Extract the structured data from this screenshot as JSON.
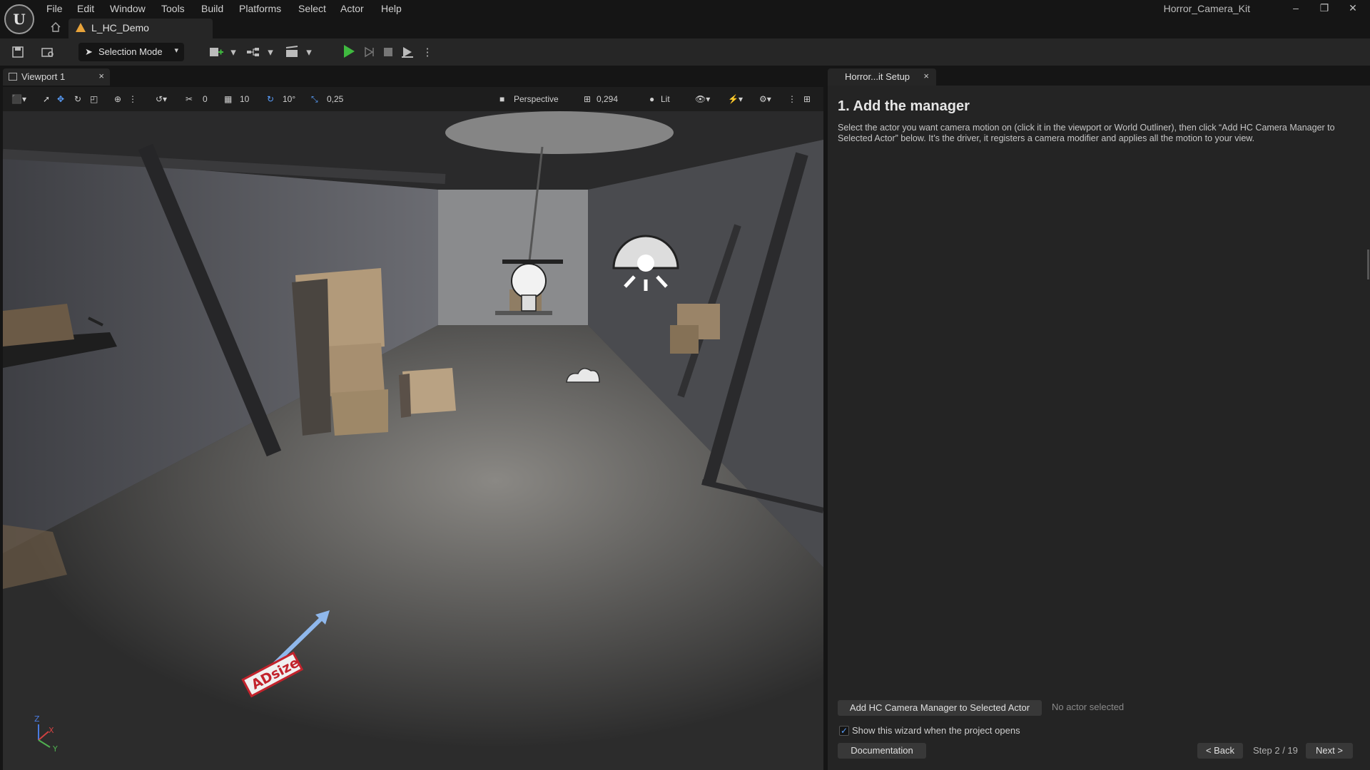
{
  "menu": {
    "items": [
      "File",
      "Edit",
      "Window",
      "Tools",
      "Build",
      "Platforms",
      "Select",
      "Actor",
      "Help"
    ]
  },
  "window": {
    "app_title": "Horror_Camera_Kit",
    "controls": [
      "–",
      "❐",
      "✕"
    ]
  },
  "level_tab": {
    "label": "L_HC_Demo"
  },
  "toolbar": {
    "selection_mode": "Selection Mode",
    "play_color": "#3fb93f"
  },
  "viewport": {
    "tab_label": "Viewport 1",
    "tab_close": "×",
    "rotation_snap_value": "0",
    "grid_snap_value": "10",
    "rotation_value": "10°",
    "scale_value": "0,25",
    "view_mode": "Perspective",
    "camera_speed": "0,294",
    "lighting_mode": "Lit",
    "overlay_text": "ADsize"
  },
  "panel": {
    "tab_label": "Horror...it Setup",
    "tab_close": "×",
    "step_title": "1. Add the manager",
    "step_description": "Select the actor you want camera motion on (click it in the viewport or World Outliner), then click “Add HC Camera Manager to Selected Actor” below. It’s the driver, it registers a camera modifier and applies all the motion to your view.",
    "add_button": "Add HC Camera Manager to Selected Actor",
    "no_actor": "No actor selected",
    "show_wizard_label": "Show this wizard when the project opens",
    "show_wizard_checked": true,
    "documentation_button": "Documentation",
    "back_button": "< Back",
    "step_count": "Step 2 / 19",
    "next_button": "Next >"
  },
  "axis": {
    "x": "X",
    "y": "Y",
    "z": "Z"
  }
}
